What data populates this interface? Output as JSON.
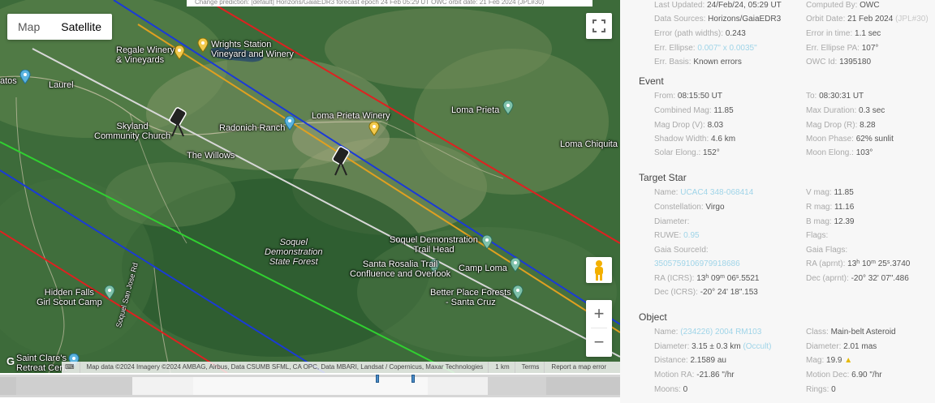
{
  "top_fragment": "Change prediction:         [default] Horizons/GaiaEDR3 forecast epoch 24 Feb 05:29 UT OWC orbit date: 21 Feb 2024 (JPL#30)",
  "map": {
    "type_options": [
      "Map",
      "Satellite"
    ],
    "active_type": "Satellite",
    "labels": {
      "regale": "Regale Winery\n& Vineyards",
      "wrights": "Wrights Station\nVineyard and Winery",
      "laurel": "Laurel",
      "atos": "atos",
      "skyland": "Skyland\nCommunity Church",
      "radonich": "Radonich Ranch",
      "willows": "The Willows",
      "loma_prieta_winery": "Loma Prieta Winery",
      "loma_prieta": "Loma Prieta",
      "loma_chiquita": "Loma Chiquita",
      "soquel_trail": "Soquel Demonstration\nTrail Head",
      "soquel_forest": "Soquel\nDemonstration\nState Forest",
      "santa_rosalia": "Santa Rosalia Trail\nConfluence and Overlook",
      "camp_loma": "Camp Loma",
      "better_place": "Better Place Forests\n- Santa Cruz",
      "hidden_falls": "Hidden Falls\nGirl Scout Camp",
      "saint_clares": "Saint Clare's\nRetreat Cent",
      "soquel_san_jose": "Soquel San Jose Rd"
    },
    "attribution": {
      "map_data": "Map data ©2024 Imagery ©2024 AMBAG, Airbus, Data CSUMB SFML, CA OPC, Data MBARI, Landsat / Copernicus, Maxar Technologies",
      "scale": "1 km",
      "terms": "Terms",
      "report": "Report a map error"
    },
    "colors": {
      "red": "#e02020",
      "blue": "#1a3ad8",
      "gray": "#d8d8d8",
      "orange": "#e0a020",
      "green": "#30d030"
    }
  },
  "panel": {
    "header": {
      "last_updated_k": "Last Updated:",
      "last_updated_v": "24/Feb/24, 05:29 UT",
      "computed_by_k": "Computed By:",
      "computed_by_v": "OWC",
      "data_sources_k": "Data Sources:",
      "data_sources_v": "Horizons/GaiaEDR3",
      "orbit_date_k": "Orbit Date:",
      "orbit_date_v": "21 Feb 2024",
      "orbit_date_note": "(JPL#30)",
      "error_paths_k": "Error (path widths):",
      "error_paths_v": "0.243",
      "error_time_k": "Error in time:",
      "error_time_v": "1.1 sec",
      "err_ellipse_k": "Err. Ellipse:",
      "err_ellipse_v": "0.007\" x 0.0035\"",
      "err_ellipse_pa_k": "Err. Ellipse PA:",
      "err_ellipse_pa_v": "107°",
      "err_basis_k": "Err. Basis:",
      "err_basis_v": "Known errors",
      "owc_id_k": "OWC Id:",
      "owc_id_v": "1395180"
    },
    "event": {
      "title": "Event",
      "from_k": "From:",
      "from_v": "08:15:50 UT",
      "to_k": "To:",
      "to_v": "08:30:31 UT",
      "combined_mag_k": "Combined Mag:",
      "combined_mag_v": "11.85",
      "max_duration_k": "Max Duration:",
      "max_duration_v": "0.3 sec",
      "mag_drop_v_k": "Mag Drop (V):",
      "mag_drop_v_v": "8.03",
      "mag_drop_r_k": "Mag Drop (R):",
      "mag_drop_r_v": "8.28",
      "shadow_width_k": "Shadow Width:",
      "shadow_width_v": "4.6 km",
      "moon_phase_k": "Moon Phase:",
      "moon_phase_v": "62% sunlit",
      "solar_elong_k": "Solar Elong.:",
      "solar_elong_v": "152°",
      "moon_elong_k": "Moon Elong.:",
      "moon_elong_v": "103°"
    },
    "target": {
      "title": "Target Star",
      "name_k": "Name:",
      "name_v": "UCAC4 348-068414",
      "vmag_k": "V mag:",
      "vmag_v": "11.85",
      "constellation_k": "Constellation:",
      "constellation_v": "Virgo",
      "rmag_k": "R mag:",
      "rmag_v": "11.16",
      "diameter_k": "Diameter:",
      "diameter_v": "",
      "bmag_k": "B mag:",
      "bmag_v": "12.39",
      "ruwe_k": "RUWE:",
      "ruwe_v": "0.95",
      "flags_k": "Flags:",
      "flags_v": "",
      "gaia_source_k": "Gaia SourceId:",
      "gaia_flags_k": "Gaia Flags:",
      "gaia_source_v": "3505759106979918686",
      "ra_apparent_k": "RA (aprnt):",
      "ra_apparent_h": "13",
      "ra_apparent_m": "10",
      "ra_apparent_s": "25",
      "ra_apparent_frac": ".3740",
      "ra_icrs_k": "RA (ICRS):",
      "ra_icrs_h": "13",
      "ra_icrs_m": "09",
      "ra_icrs_s": "06",
      "ra_icrs_frac": ".5521",
      "dec_apparent_k": "Dec (aprnt):",
      "dec_apparent_v": "-20° 32' 07\".486",
      "dec_icrs_k": "Dec (ICRS):",
      "dec_icrs_v": "-20° 24' 18\".153"
    },
    "object": {
      "title": "Object",
      "name_k": "Name:",
      "name_v": "(234226) 2004 RM103",
      "class_k": "Class:",
      "class_v": "Main-belt Asteroid",
      "diameter_k": "Diameter:",
      "diameter_v": "3.15 ± 0.3 km",
      "diameter_note": "(Occult)",
      "diameter2_k": "Diameter:",
      "diameter2_v": "2.01 mas",
      "distance_k": "Distance:",
      "distance_v": "2.1589 au",
      "mag_k": "Mag:",
      "mag_v": "19.9",
      "motion_ra_k": "Motion RA:",
      "motion_ra_v": "-21.86 \"/hr",
      "motion_dec_k": "Motion Dec:",
      "motion_dec_v": "6.90 \"/hr",
      "moons_k": "Moons:",
      "moons_v": "0",
      "rings_k": "Rings:",
      "rings_v": "0"
    }
  }
}
